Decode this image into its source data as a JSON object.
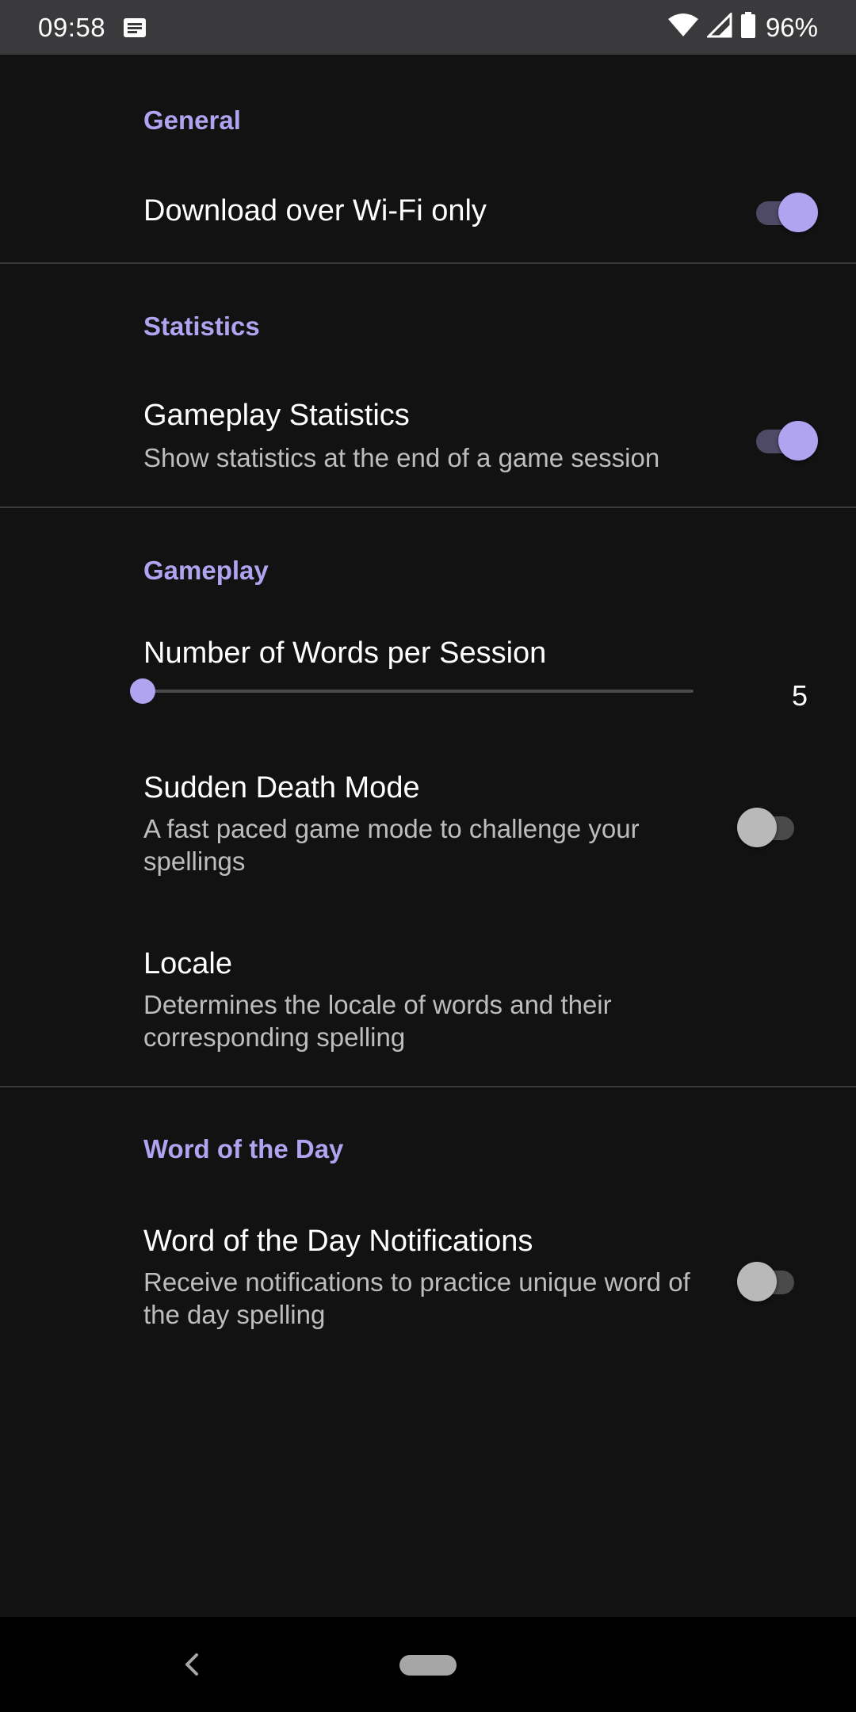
{
  "status_bar": {
    "time": "09:58",
    "battery": "96%",
    "icons": [
      "notification-icon",
      "wifi-icon",
      "signal-icon",
      "battery-icon"
    ]
  },
  "colors": {
    "accent": "#b0a3f0",
    "background": "#121212",
    "summary_text": "#bdbdbd"
  },
  "sections": {
    "general": {
      "title": "General",
      "wifi_only": {
        "title": "Download over Wi-Fi only",
        "enabled": true
      }
    },
    "statistics": {
      "title": "Statistics",
      "gameplay_stats": {
        "title": "Gameplay Statistics",
        "summary": "Show statistics at the end of a game session",
        "enabled": true
      }
    },
    "gameplay": {
      "title": "Gameplay",
      "words_per_session": {
        "title": "Number of Words per Session",
        "value": "5",
        "fraction": 0.0
      },
      "sudden_death": {
        "title": "Sudden Death Mode",
        "summary": "A fast paced game mode to challenge your spellings",
        "enabled": false
      },
      "locale": {
        "title": "Locale",
        "summary": "Determines the locale of words and their corresponding spelling"
      }
    },
    "word_of_day": {
      "title": "Word of the Day",
      "notifications": {
        "title": "Word of the Day Notifications",
        "summary": "Receive notifications to practice unique word of the day spelling",
        "enabled": false
      }
    }
  },
  "nav_bar": {
    "back_icon": "back-chevron-icon",
    "home_icon": "home-pill-icon"
  }
}
